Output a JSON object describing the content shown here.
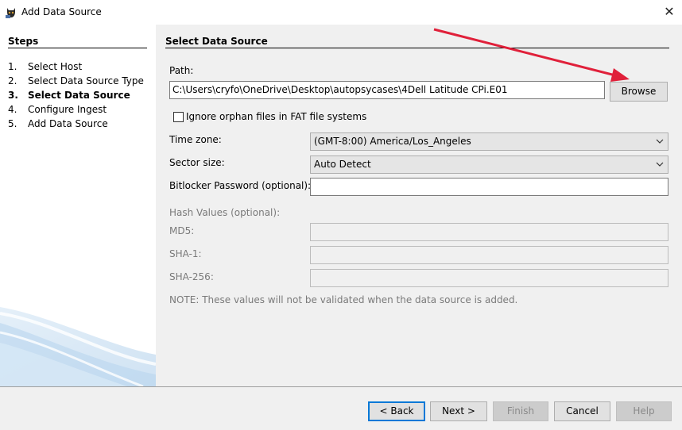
{
  "window": {
    "title": "Add Data Source",
    "close_glyph": "✕"
  },
  "steps": {
    "title": "Steps",
    "items": [
      {
        "num": "1.",
        "label": "Select Host"
      },
      {
        "num": "2.",
        "label": "Select Data Source Type"
      },
      {
        "num": "3.",
        "label": "Select Data Source",
        "active": true
      },
      {
        "num": "4.",
        "label": "Configure Ingest"
      },
      {
        "num": "5.",
        "label": "Add Data Source"
      }
    ]
  },
  "panel": {
    "title": "Select Data Source",
    "path_label": "Path:",
    "path_value": "C:\\Users\\cryfo\\OneDrive\\Desktop\\autopsycases\\4Dell Latitude CPi.E01",
    "browse_label": "Browse",
    "ignore_orphan_label": "Ignore orphan files in FAT file systems",
    "ignore_orphan_checked": false,
    "timezone_label": "Time zone:",
    "timezone_value": "(GMT-8:00) America/Los_Angeles",
    "sector_label": "Sector size:",
    "sector_value": "Auto Detect",
    "bitlocker_label": "Bitlocker Password (optional):",
    "bitlocker_value": "",
    "hash_title": "Hash Values (optional):",
    "md5_label": "MD5:",
    "sha1_label": "SHA-1:",
    "sha256_label": "SHA-256:",
    "note": "NOTE: These values will not be validated when the data source is added."
  },
  "buttons": {
    "back": "< Back",
    "next": "Next >",
    "finish": "Finish",
    "cancel": "Cancel",
    "help": "Help"
  },
  "colors": {
    "annotation_arrow": "#e0203a",
    "focus_border": "#0078d7",
    "panel_bg": "#f0f0f0"
  }
}
